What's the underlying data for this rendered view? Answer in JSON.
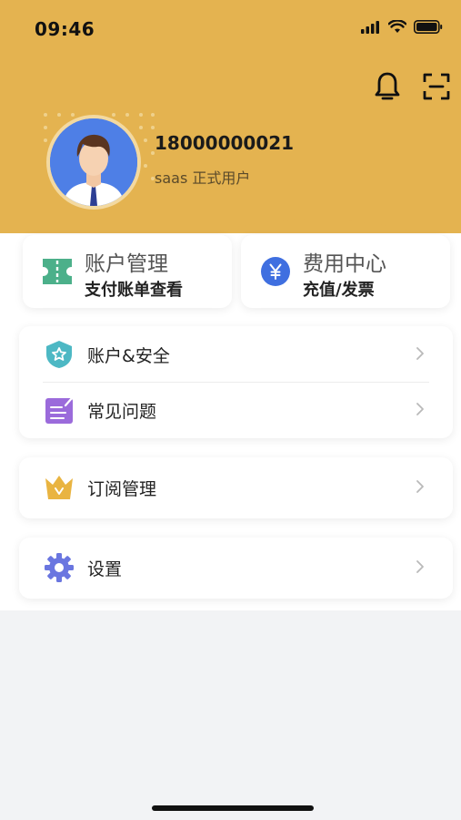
{
  "status_bar": {
    "time": "09:46"
  },
  "header": {
    "top_icons": [
      "bell-icon",
      "scan-icon"
    ],
    "user": {
      "phone": "18000000021",
      "type": "saas 正式用户"
    }
  },
  "quick_cards": [
    {
      "title": "账户管理",
      "subtitle": "支付账单查看",
      "icon": "ticket-icon",
      "icon_color": "#4cb08a"
    },
    {
      "title": "费用中心",
      "subtitle": "充值/发票",
      "icon": "yen-icon",
      "icon_color": "#3f6fe0"
    }
  ],
  "menu_group_1": [
    {
      "label": "账户&安全",
      "icon": "shield-icon",
      "icon_color": "#4db8c4"
    },
    {
      "label": "常见问题",
      "icon": "faq-icon",
      "icon_color": "#9b6bdb"
    }
  ],
  "menu_group_2": [
    {
      "label": "订阅管理",
      "icon": "crown-icon",
      "icon_color": "#e9b441"
    }
  ],
  "menu_group_3": [
    {
      "label": "设置",
      "icon": "gear-icon",
      "icon_color": "#6a76e0"
    }
  ],
  "colors": {
    "header_bg": "#e4b350",
    "page_bg": "#f2f3f5"
  }
}
